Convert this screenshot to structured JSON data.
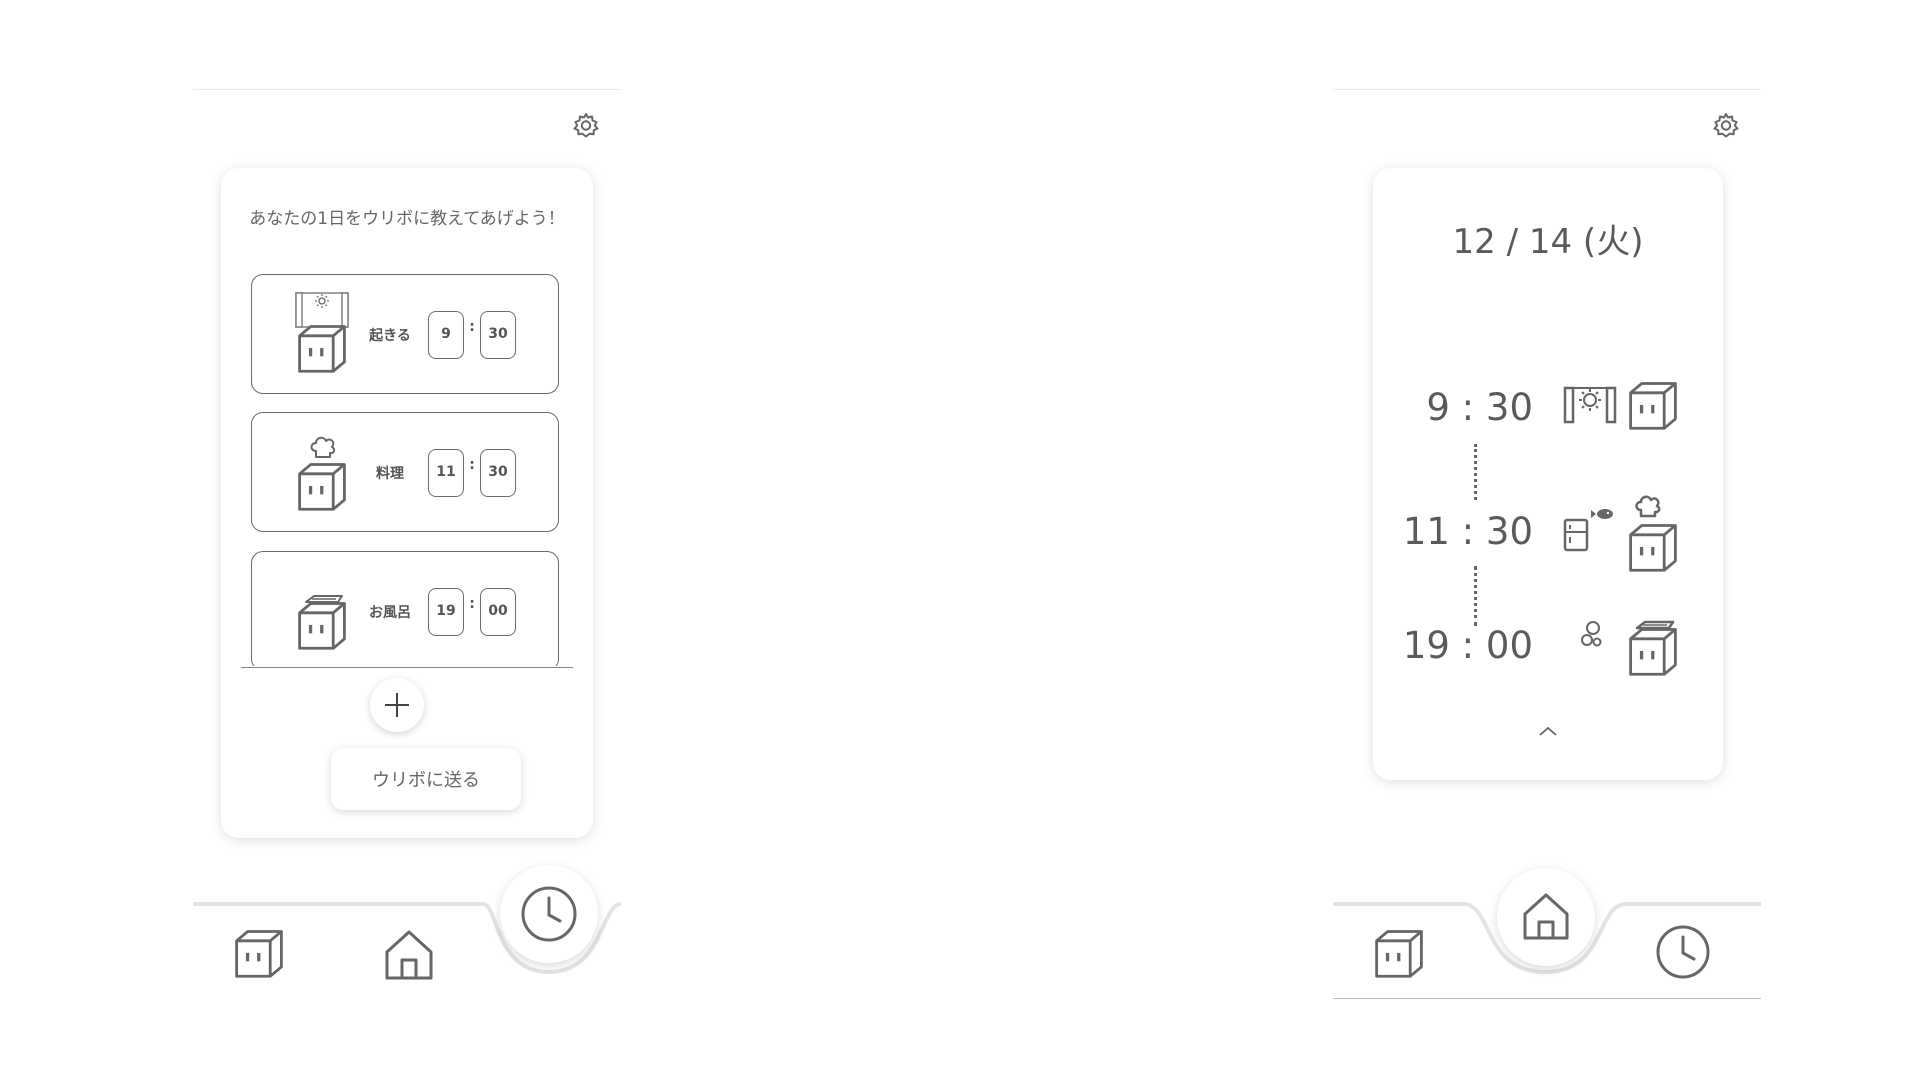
{
  "planner": {
    "prompt": "あなたの1日をウリボに教えてあげよう！",
    "colon": ":",
    "items": [
      {
        "label": "起きる",
        "hour": "9",
        "minute": "30",
        "icon": "wake-up-icon"
      },
      {
        "label": "料理",
        "hour": "11",
        "minute": "30",
        "icon": "cooking-icon"
      },
      {
        "label": "お風呂",
        "hour": "19",
        "minute": "00",
        "icon": "bath-icon"
      }
    ],
    "send_label": "ウリボに送る",
    "active_tab": "schedule"
  },
  "today": {
    "date": "12 / 14 (火)",
    "entries": [
      {
        "time": "9 : 30",
        "icon": "sunrise-window-icon"
      },
      {
        "time": "11 : 30",
        "icon": "fridge-fish-icon"
      },
      {
        "time": "19 : 00",
        "icon": "bubbles-icon"
      }
    ],
    "active_tab": "home"
  },
  "nav": [
    "robot",
    "home",
    "clock"
  ],
  "colors": {
    "stroke": "#666666",
    "text": "#5a5a5a",
    "background": "#ffffff",
    "shadow": "#d0d0d0"
  }
}
